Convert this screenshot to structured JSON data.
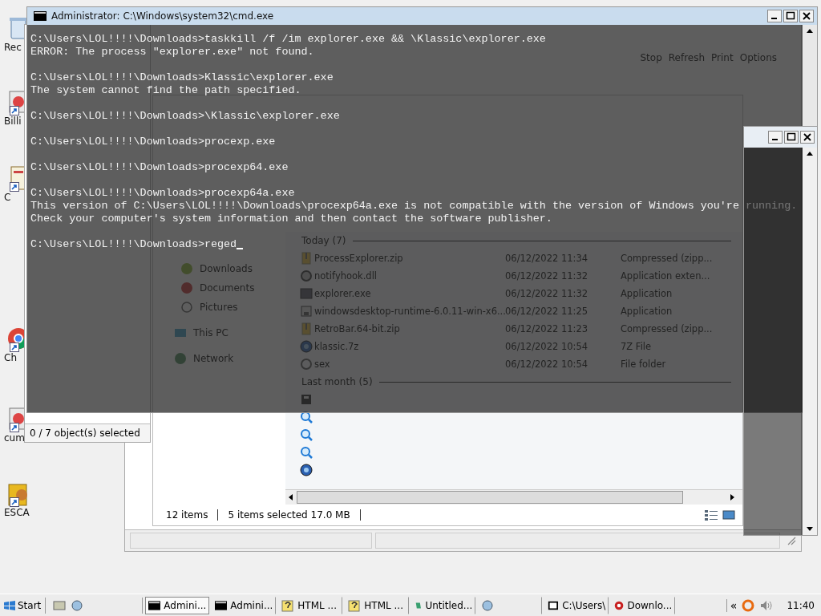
{
  "desktop_icons": [
    {
      "label": "Rec",
      "kind": "bin"
    },
    {
      "label": "Billi",
      "kind": "app"
    },
    {
      "label": "C",
      "kind": "doc"
    },
    {
      "label": "Ch",
      "kind": "chrome"
    },
    {
      "label": "cum",
      "kind": "app"
    },
    {
      "label": "ESCA",
      "kind": "folder"
    }
  ],
  "browser_window": {
    "toolbar": [
      "Stop",
      "Refresh",
      "Print",
      "Options"
    ]
  },
  "archive_window": {
    "status": "0 / 7 object(s) selected"
  },
  "explorer_window": {
    "nav": [
      "Downloads",
      "Documents",
      "Pictures",
      "This PC",
      "Network"
    ],
    "groups": [
      {
        "title": "Today (7)",
        "rows": [
          {
            "name": "ProcessExplorer.zip",
            "date": "06/12/2022 11:34",
            "type": "Compressed (zipp...",
            "kind": "zip"
          },
          {
            "name": "notifyhook.dll",
            "date": "06/12/2022 11:32",
            "type": "Application exten...",
            "kind": "gear"
          },
          {
            "name": "explorer.exe",
            "date": "06/12/2022 11:32",
            "type": "Application",
            "kind": "window"
          },
          {
            "name": "windowsdesktop-runtime-6.0.11-win-x6...",
            "date": "06/12/2022 11:25",
            "type": "Application",
            "kind": "installer"
          },
          {
            "name": "RetroBar.64-bit.zip",
            "date": "06/12/2022 11:23",
            "type": "Compressed (zipp...",
            "kind": "zip"
          },
          {
            "name": "klassic.7z",
            "date": "06/12/2022 10:54",
            "type": "7Z File",
            "kind": "globe"
          },
          {
            "name": "sex",
            "date": "06/12/2022 10:54",
            "type": "File folder",
            "kind": "ring"
          }
        ]
      },
      {
        "title": "Last month (5)",
        "rows": [
          {
            "kind": "archive"
          },
          {
            "kind": "search"
          },
          {
            "kind": "search"
          },
          {
            "kind": "search"
          },
          {
            "kind": "globe"
          }
        ]
      }
    ],
    "status": [
      "12 items",
      "5 items selected  17.0 MB"
    ]
  },
  "cmd_window": {
    "title": "Administrator: C:\\Windows\\system32\\cmd.exe",
    "blocks": [
      [
        "C:\\Users\\LOL!!!!\\Downloads>taskkill /f /im explorer.exe && \\Klassic\\explorer.exe",
        "ERROR: The process \"explorer.exe\" not found."
      ],
      [
        "C:\\Users\\LOL!!!!\\Downloads>Klassic\\explorer.exe",
        "The system cannot find the path specified."
      ],
      [
        "C:\\Users\\LOL!!!!\\Downloads>\\Klassic\\explorer.exe"
      ],
      [
        "C:\\Users\\LOL!!!!\\Downloads>procexp.exe"
      ],
      [
        "C:\\Users\\LOL!!!!\\Downloads>procexp64.exe"
      ],
      [
        "C:\\Users\\LOL!!!!\\Downloads>procexp64a.exe",
        "This version of C:\\Users\\LOL!!!!\\Downloads\\procexp64a.exe is not compatible with the version of Windows you're running.",
        "Check your computer's system information and then contact the software publisher."
      ],
      [
        "C:\\Users\\LOL!!!!\\Downloads>reged"
      ]
    ]
  },
  "taskbar": {
    "start": "Start",
    "tasks": [
      {
        "label": "Admini...",
        "kind": "console",
        "selected": true
      },
      {
        "label": "Admini...",
        "kind": "console",
        "selected": false
      },
      {
        "label": "HTML ...",
        "kind": "help",
        "selected": false
      },
      {
        "label": "HTML ...",
        "kind": "help",
        "selected": false
      },
      {
        "label": "Untitled...",
        "kind": "notepad",
        "selected": false
      },
      {
        "kind": "blank",
        "selected": false
      },
      {
        "label": "C:\\Users\\",
        "kind": "archive",
        "selected": false
      },
      {
        "label": "Downlo...",
        "kind": "browser",
        "selected": false
      }
    ],
    "tray_toggle": "«",
    "clock": "11:40"
  }
}
